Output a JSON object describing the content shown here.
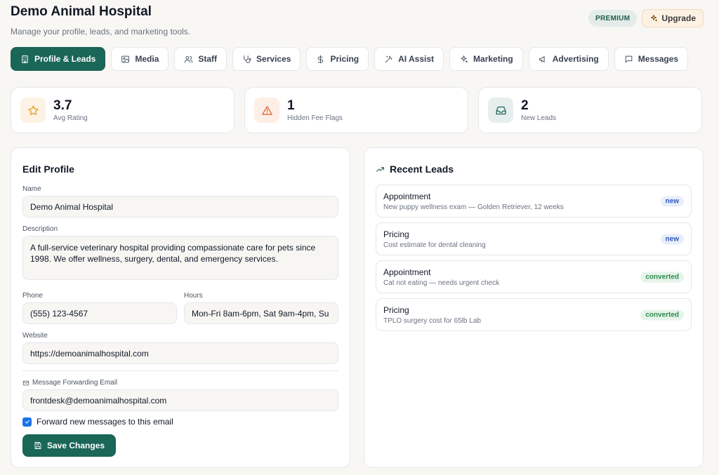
{
  "header": {
    "title": "Demo Animal Hospital",
    "subtitle": "Manage your profile, leads, and marketing tools.",
    "premium_badge": "PREMIUM",
    "upgrade_label": "Upgrade"
  },
  "tabs": [
    {
      "label": "Profile & Leads",
      "icon": "building-icon",
      "active": true
    },
    {
      "label": "Media",
      "icon": "image-icon"
    },
    {
      "label": "Staff",
      "icon": "users-icon"
    },
    {
      "label": "Services",
      "icon": "stethoscope-icon"
    },
    {
      "label": "Pricing",
      "icon": "dollar-icon"
    },
    {
      "label": "AI Assist",
      "icon": "wand-icon"
    },
    {
      "label": "Marketing",
      "icon": "sparkles-icon"
    },
    {
      "label": "Advertising",
      "icon": "megaphone-icon"
    },
    {
      "label": "Messages",
      "icon": "message-icon"
    }
  ],
  "stats": [
    {
      "value": "3.7",
      "label": "Avg Rating",
      "icon": "star-icon"
    },
    {
      "value": "1",
      "label": "Hidden Fee Flags",
      "icon": "alert-icon"
    },
    {
      "value": "2",
      "label": "New Leads",
      "icon": "inbox-icon"
    }
  ],
  "edit_profile": {
    "title": "Edit Profile",
    "name_label": "Name",
    "name_value": "Demo Animal Hospital",
    "description_label": "Description",
    "description_value": "A full-service veterinary hospital providing compassionate care for pets since 1998. We offer wellness, surgery, dental, and emergency services.",
    "phone_label": "Phone",
    "phone_value": "(555) 123-4567",
    "hours_label": "Hours",
    "hours_value": "Mon-Fri 8am-6pm, Sat 9am-4pm, Su",
    "website_label": "Website",
    "website_value": "https://demoanimalhospital.com",
    "email_label": "Message Forwarding Email",
    "email_value": "frontdesk@demoanimalhospital.com",
    "forward_checkbox_label": "Forward new messages to this email",
    "forward_checked": true,
    "save_label": "Save Changes"
  },
  "recent_leads": {
    "title": "Recent Leads",
    "items": [
      {
        "type": "Appointment",
        "desc": "New puppy wellness exam — Golden Retriever, 12 weeks",
        "status": "new"
      },
      {
        "type": "Pricing",
        "desc": "Cost estimate for dental cleaning",
        "status": "new"
      },
      {
        "type": "Appointment",
        "desc": "Cat not eating — needs urgent check",
        "status": "converted"
      },
      {
        "type": "Pricing",
        "desc": "TPLO surgery cost for 65lb Lab",
        "status": "converted"
      }
    ]
  }
}
